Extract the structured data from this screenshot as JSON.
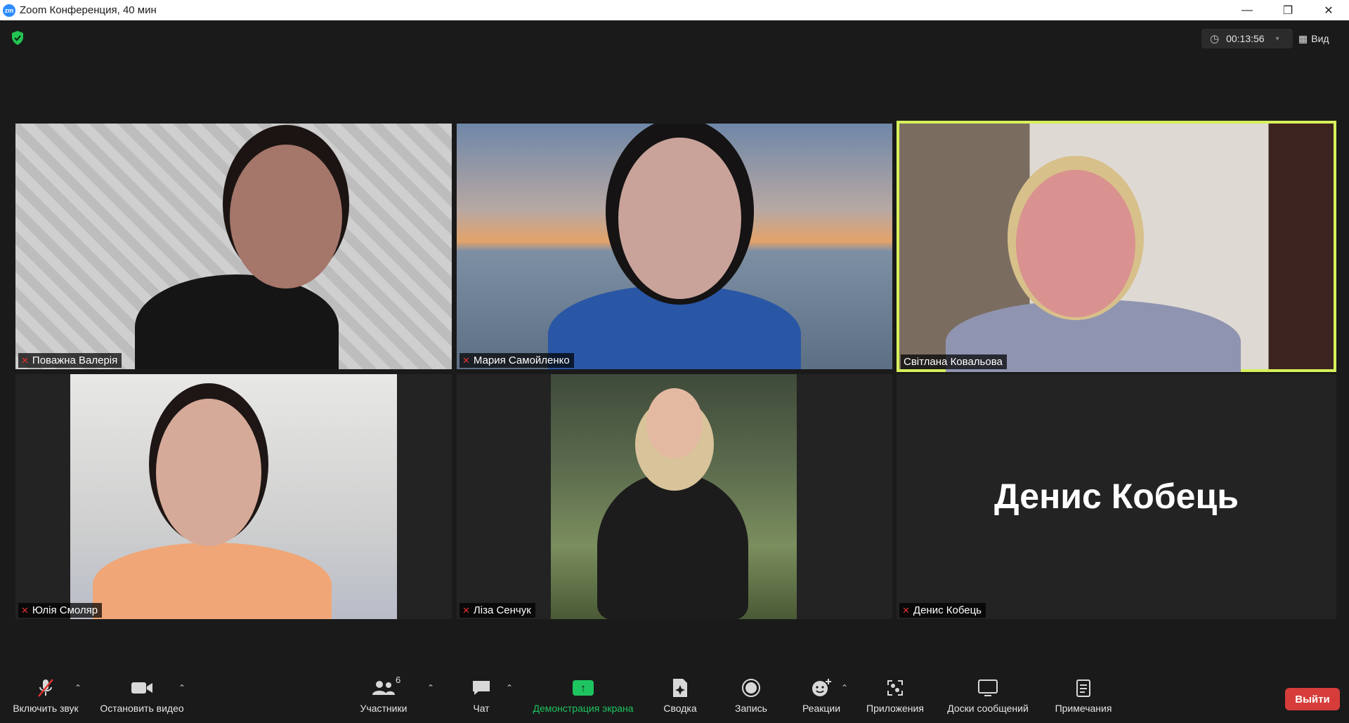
{
  "window": {
    "title": "Zoom Конференция, 40 мин",
    "logo": "zm",
    "controls": [
      "—",
      "❐",
      "✕"
    ]
  },
  "topbar": {
    "timer": "00:13:56",
    "view_label": "Вид"
  },
  "tiles": [
    {
      "name": "Поважна Валерія",
      "muted": true
    },
    {
      "name": "Мария Самойленко",
      "muted": true
    },
    {
      "name": "Світлана Ковальова",
      "muted": false,
      "active": true
    },
    {
      "name": "Юлія Смоляр",
      "muted": true
    },
    {
      "name": "Ліза Сенчук",
      "muted": true
    },
    {
      "name": "Денис Кобець",
      "muted": true,
      "video_off": true,
      "big_name": "Денис Кобець"
    }
  ],
  "toolbar": {
    "mute_label": "Включить звук",
    "video_label": "Остановить видео",
    "participants_label": "Участники",
    "participants_count": "6",
    "chat_label": "Чат",
    "share_label": "Демонстрация экрана",
    "summary_label": "Сводка",
    "record_label": "Запись",
    "reactions_label": "Реакции",
    "apps_label": "Приложения",
    "whiteboards_label": "Доски сообщений",
    "notes_label": "Примечания",
    "leave_label": "Выйти"
  },
  "colors": {
    "active_speaker": "#d6f05a",
    "leave": "#d63d3a",
    "share": "#1ec45f",
    "muted": "#e0302e"
  }
}
